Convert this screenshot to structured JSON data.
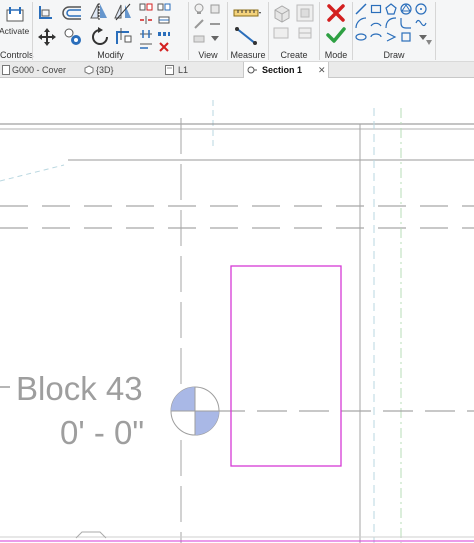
{
  "ribbon": {
    "groups": {
      "controls": "Controls",
      "modify": "Modify",
      "view": "View",
      "measure": "Measure",
      "create": "Create",
      "mode": "Mode",
      "draw": "Draw"
    },
    "activate_label": "Activate",
    "colors": {
      "accent_blue": "#2a6ebb",
      "cancel_red": "#d32020",
      "finish_green": "#2ea043"
    }
  },
  "tabs": [
    {
      "label": "G000 - Cover",
      "icon": "sheet-icon"
    },
    {
      "label": "{3D}",
      "icon": "3d-view-icon"
    },
    {
      "label": "L1",
      "icon": "plan-view-icon"
    },
    {
      "label": "Section 1",
      "icon": "section-view-icon",
      "active": true,
      "close": "✕"
    }
  ],
  "canvas": {
    "level_name": "Block 43",
    "level_elevation": "0' - 0\"",
    "colors": {
      "sketch_magenta": "#d63ad6",
      "level_gray": "#9e9e9e",
      "marker_blue": "#a9b8e6"
    }
  }
}
